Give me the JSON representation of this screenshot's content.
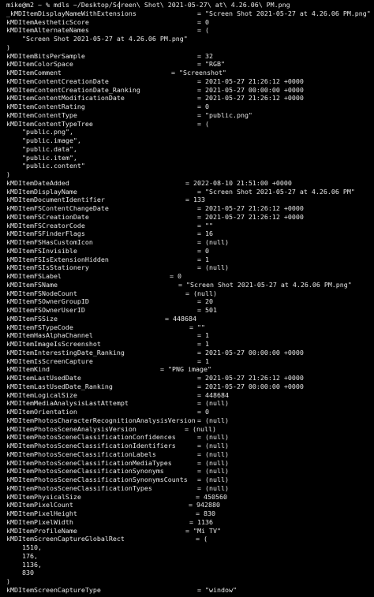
{
  "command": "mike@m2 ~ % mdls ~/Desktop/Screen\\ Shot\\ 2021-05-27\\ at\\ 4.26.06\\ PM.png",
  "lines": [
    {
      "type": "kv",
      "key": "_kMDItemDisplayNameWithExtensions",
      "val": "= \"Screen Shot 2021-05-27 at 4.26.06 PM.png\""
    },
    {
      "type": "kv",
      "key": "kMDItemAestheticScore",
      "val": "= 0"
    },
    {
      "type": "kv",
      "key": "kMDItemAlternateNames",
      "val": "= ("
    },
    {
      "type": "item",
      "text": "\"Screen Shot 2021-05-27 at 4.26.06 PM.png\""
    },
    {
      "type": "close",
      "text": ")"
    },
    {
      "type": "kv",
      "key": "kMDItemBitsPerSample",
      "val": "= 32"
    },
    {
      "type": "kv",
      "key": "kMDItemColorSpace",
      "val": "= \"RGB\""
    },
    {
      "type": "kv",
      "key": "kMDItemComment",
      "val": "= \"Screenshot\""
    },
    {
      "type": "kv",
      "key": "kMDItemContentCreationDate",
      "val": "= 2021-05-27 21:26:12 +0000"
    },
    {
      "type": "kv",
      "key": "kMDItemContentCreationDate_Ranking",
      "val": "= 2021-05-27 00:00:00 +0000"
    },
    {
      "type": "kv",
      "key": "kMDItemContentModificationDate",
      "val": "= 2021-05-27 21:26:12 +0000"
    },
    {
      "type": "kv",
      "key": "kMDItemContentRating",
      "val": "= 0"
    },
    {
      "type": "kv",
      "key": "kMDItemContentType",
      "val": "= \"public.png\""
    },
    {
      "type": "kv",
      "key": "kMDItemContentTypeTree",
      "val": "= ("
    },
    {
      "type": "item",
      "text": "\"public.png\","
    },
    {
      "type": "item",
      "text": "\"public.image\","
    },
    {
      "type": "item",
      "text": "\"public.data\","
    },
    {
      "type": "item",
      "text": "\"public.item\","
    },
    {
      "type": "item",
      "text": "\"public.content\""
    },
    {
      "type": "close",
      "text": ")"
    },
    {
      "type": "kv",
      "key": "kMDItemDateAdded",
      "val": "= 2022-08-10 21:51:00 +0000"
    },
    {
      "type": "kv",
      "key": "kMDItemDisplayName",
      "val": "= \"Screen Shot 2021-05-27 at 4.26.06 PM\""
    },
    {
      "type": "kv",
      "key": "kMDItemDocumentIdentifier",
      "val": "= 133"
    },
    {
      "type": "kv",
      "key": "kMDItemFSContentChangeDate",
      "val": "= 2021-05-27 21:26:12 +0000"
    },
    {
      "type": "kv",
      "key": "kMDItemFSCreationDate",
      "val": "= 2021-05-27 21:26:12 +0000"
    },
    {
      "type": "kv",
      "key": "kMDItemFSCreatorCode",
      "val": "= \"\""
    },
    {
      "type": "kv",
      "key": "kMDItemFSFinderFlags",
      "val": "= 16"
    },
    {
      "type": "kv",
      "key": "kMDItemFSHasCustomIcon",
      "val": "= (null)"
    },
    {
      "type": "kv",
      "key": "kMDItemFSInvisible",
      "val": "= 0"
    },
    {
      "type": "kv",
      "key": "kMDItemFSIsExtensionHidden",
      "val": "= 1"
    },
    {
      "type": "kv",
      "key": "kMDItemFSIsStationery",
      "val": "= (null)"
    },
    {
      "type": "kv",
      "key": "kMDItemFSLabel",
      "val": "= 0"
    },
    {
      "type": "kv",
      "key": "kMDItemFSName",
      "val": "= \"Screen Shot 2021-05-27 at 4.26.06 PM.png\""
    },
    {
      "type": "kv",
      "key": "kMDItemFSNodeCount",
      "val": "= (null)"
    },
    {
      "type": "kv",
      "key": "kMDItemFSOwnerGroupID",
      "val": "= 20"
    },
    {
      "type": "kv",
      "key": "kMDItemFSOwnerUserID",
      "val": "= 501"
    },
    {
      "type": "kv",
      "key": "kMDItemFSSize",
      "val": "= 448684"
    },
    {
      "type": "kv",
      "key": "kMDItemFSTypeCode",
      "val": "= \"\""
    },
    {
      "type": "kv",
      "key": "kMDItemHasAlphaChannel",
      "val": "= 1"
    },
    {
      "type": "kv",
      "key": "kMDItemImageIsScreenshot",
      "val": "= 1"
    },
    {
      "type": "kv",
      "key": "kMDItemInterestingDate_Ranking",
      "val": "= 2021-05-27 00:00:00 +0000"
    },
    {
      "type": "kv",
      "key": "kMDItemIsScreenCapture",
      "val": "= 1"
    },
    {
      "type": "kv",
      "key": "kMDItemKind",
      "val": "= \"PNG image\""
    },
    {
      "type": "kv",
      "key": "kMDItemLastUsedDate",
      "val": "= 2021-05-27 21:26:12 +0000"
    },
    {
      "type": "kv",
      "key": "kMDItemLastUsedDate_Ranking",
      "val": "= 2021-05-27 00:00:00 +0000"
    },
    {
      "type": "kv",
      "key": "kMDItemLogicalSize",
      "val": "= 448684"
    },
    {
      "type": "kv",
      "key": "kMDItemMediaAnalysisLastAttempt",
      "val": "= (null)"
    },
    {
      "type": "kv",
      "key": "kMDItemOrientation",
      "val": "= 0"
    },
    {
      "type": "kv",
      "key": "kMDItemPhotosCharacterRecognitionAnalysisVersion",
      "val": "= (null)"
    },
    {
      "type": "kv",
      "key": "kMDItemPhotosSceneAnalysisVersion",
      "val": "= (null)"
    },
    {
      "type": "kv",
      "key": "kMDItemPhotosSceneClassificationConfidences",
      "val": "= (null)"
    },
    {
      "type": "kv",
      "key": "kMDItemPhotosSceneClassificationIdentifiers",
      "val": "= (null)"
    },
    {
      "type": "kv",
      "key": "kMDItemPhotosSceneClassificationLabels",
      "val": "= (null)"
    },
    {
      "type": "kv",
      "key": "kMDItemPhotosSceneClassificationMediaTypes",
      "val": "= (null)"
    },
    {
      "type": "kv",
      "key": "kMDItemPhotosSceneClassificationSynonyms",
      "val": "= (null)"
    },
    {
      "type": "kv",
      "key": "kMDItemPhotosSceneClassificationSynonymsCounts",
      "val": "= (null)"
    },
    {
      "type": "kv",
      "key": "kMDItemPhotosSceneClassificationTypes",
      "val": "= (null)"
    },
    {
      "type": "kv",
      "key": "kMDItemPhysicalSize",
      "val": "= 450560"
    },
    {
      "type": "kv",
      "key": "kMDItemPixelCount",
      "val": "= 942880"
    },
    {
      "type": "kv",
      "key": "kMDItemPixelHeight",
      "val": "= 830"
    },
    {
      "type": "kv",
      "key": "kMDItemPixelWidth",
      "val": "= 1136"
    },
    {
      "type": "kv",
      "key": "kMDItemProfileName",
      "val": "= \"Mi TV\""
    },
    {
      "type": "kv",
      "key": "kMDItemScreenCaptureGlobalRect",
      "val": "= ("
    },
    {
      "type": "item",
      "text": "1510,"
    },
    {
      "type": "item",
      "text": "176,"
    },
    {
      "type": "item",
      "text": "1136,"
    },
    {
      "type": "item",
      "text": "830"
    },
    {
      "type": "close",
      "text": ")"
    },
    {
      "type": "kv",
      "key": "kMDItemScreenCaptureType",
      "val": "= \"window\""
    }
  ]
}
